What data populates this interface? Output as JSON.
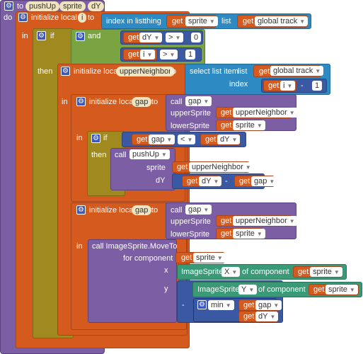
{
  "procedure": {
    "keyword_to": "to",
    "name": "pushUp",
    "params": [
      "sprite",
      "dY"
    ],
    "keyword_do": "do"
  },
  "block1": {
    "label": "initialize local",
    "var": "i",
    "to": "to",
    "in": "in"
  },
  "index_in_list": {
    "label": "index in list",
    "thing": "thing",
    "list": "list"
  },
  "get": "get",
  "names": {
    "sprite": "sprite",
    "global_track": "global track",
    "dY": "dY",
    "i": "i",
    "gap": "gap",
    "upperNeighbor": "upperNeighbor",
    "pushUp": "pushUp"
  },
  "if_block": {
    "if": "if",
    "then": "then",
    "and": "and"
  },
  "numbers": {
    "zero": "0",
    "one": "1",
    "one_b": "1"
  },
  "ops": {
    "gt": ">",
    "gt2": ">",
    "lt": "<",
    "minus": "-",
    "minus2": "-",
    "minus3": "-"
  },
  "block2": {
    "label": "initialize local",
    "var": "upperNeighbor",
    "to": "to",
    "then": "then",
    "in": "in"
  },
  "select_list": {
    "label": "select list item",
    "list": "list",
    "index": "index"
  },
  "block3": {
    "label": "initialize local",
    "var": "gap",
    "to": "to",
    "in": "in"
  },
  "call_gap": {
    "call": "call",
    "name": "gap",
    "upper": "upperSprite",
    "lower": "lowerSprite"
  },
  "call_pushup": {
    "call": "call",
    "name": "pushUp",
    "sprite": "sprite",
    "dY": "dY"
  },
  "block4": {
    "label": "initialize local",
    "var": "gap",
    "to": "to",
    "in": "in"
  },
  "call_gap2": {
    "call": "call",
    "name": "gap",
    "upper": "upperSprite",
    "lower": "lowerSprite"
  },
  "moveto": {
    "label": "call ImageSprite.MoveTo",
    "for_component": "for component",
    "x": "x",
    "y": "y"
  },
  "prop_x": {
    "label": "ImageSprite.",
    "prop": "X",
    "of_component": "of component"
  },
  "prop_y": {
    "label": "ImageSprite.",
    "prop": "Y",
    "of_component": "of component"
  },
  "min": {
    "label": "min"
  }
}
